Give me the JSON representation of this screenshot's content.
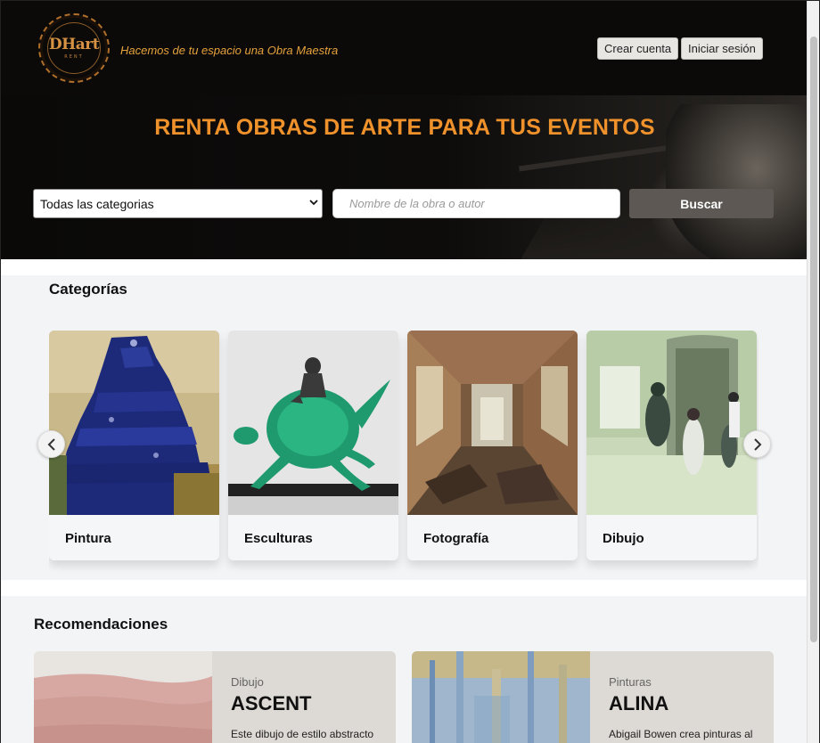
{
  "header": {
    "logo_main": "DHart",
    "logo_sub": "RENT",
    "tagline": "Hacemos de tu espacio una Obra Maestra",
    "signup_label": "Crear cuenta",
    "login_label": "Iniciar sesión"
  },
  "hero": {
    "title": "RENTA OBRAS DE ARTE PARA TUS EVENTOS",
    "category_select": "Todas las categorias",
    "search_placeholder": "Nombre de la obra o autor",
    "search_button": "Buscar"
  },
  "categories": {
    "title": "Categorías",
    "items": [
      {
        "label": "Pintura",
        "icon": "painting-image"
      },
      {
        "label": "Esculturas",
        "icon": "sculpture-image"
      },
      {
        "label": "Fotografía",
        "icon": "photograph-image"
      },
      {
        "label": "Dibujo",
        "icon": "drawing-image"
      }
    ],
    "prev_icon": "chevron-left-icon",
    "next_icon": "chevron-right-icon"
  },
  "recommendations": {
    "title": "Recomendaciones",
    "items": [
      {
        "category": "Dibujo",
        "name": "ASCENT",
        "description": "Este dibujo de estilo abstracto"
      },
      {
        "category": "Pinturas",
        "name": "ALINA",
        "description": "Abigail Bowen crea pinturas al"
      }
    ]
  },
  "colors": {
    "accent": "#f0922b",
    "header_bg": "#0b0a09",
    "search_button_bg": "#5d5854",
    "section_bg": "#f3f4f6"
  }
}
